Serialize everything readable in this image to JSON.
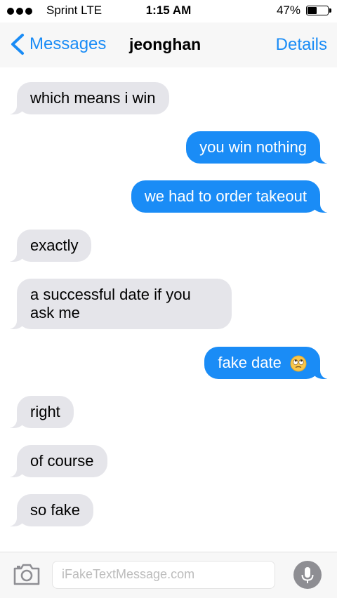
{
  "status_bar": {
    "carrier": "Sprint  LTE",
    "time": "1:15 AM",
    "battery_percent": "47%",
    "battery_level": 0.47
  },
  "nav": {
    "back_label": "Messages",
    "title": "jeonghan",
    "details_label": "Details",
    "accent_color": "#1a8cf6"
  },
  "messages": [
    {
      "direction": "received",
      "text": "which means i win"
    },
    {
      "direction": "sent",
      "text": "you win nothing"
    },
    {
      "direction": "sent",
      "text": "we had to order takeout"
    },
    {
      "direction": "received",
      "text": "exactly"
    },
    {
      "direction": "received",
      "text": "a successful date if you ask me"
    },
    {
      "direction": "sent",
      "text": "fake date",
      "emoji": "eye-roll-emoji"
    },
    {
      "direction": "received",
      "text": "right"
    },
    {
      "direction": "received",
      "text": "of course"
    },
    {
      "direction": "received",
      "text": "so fake"
    }
  ],
  "input_bar": {
    "placeholder": "iFakeTextMessage.com",
    "camera_icon": "camera-icon",
    "mic_icon": "microphone-icon"
  },
  "colors": {
    "sent_bubble": "#1a8cf6",
    "received_bubble": "#e5e5ea"
  }
}
